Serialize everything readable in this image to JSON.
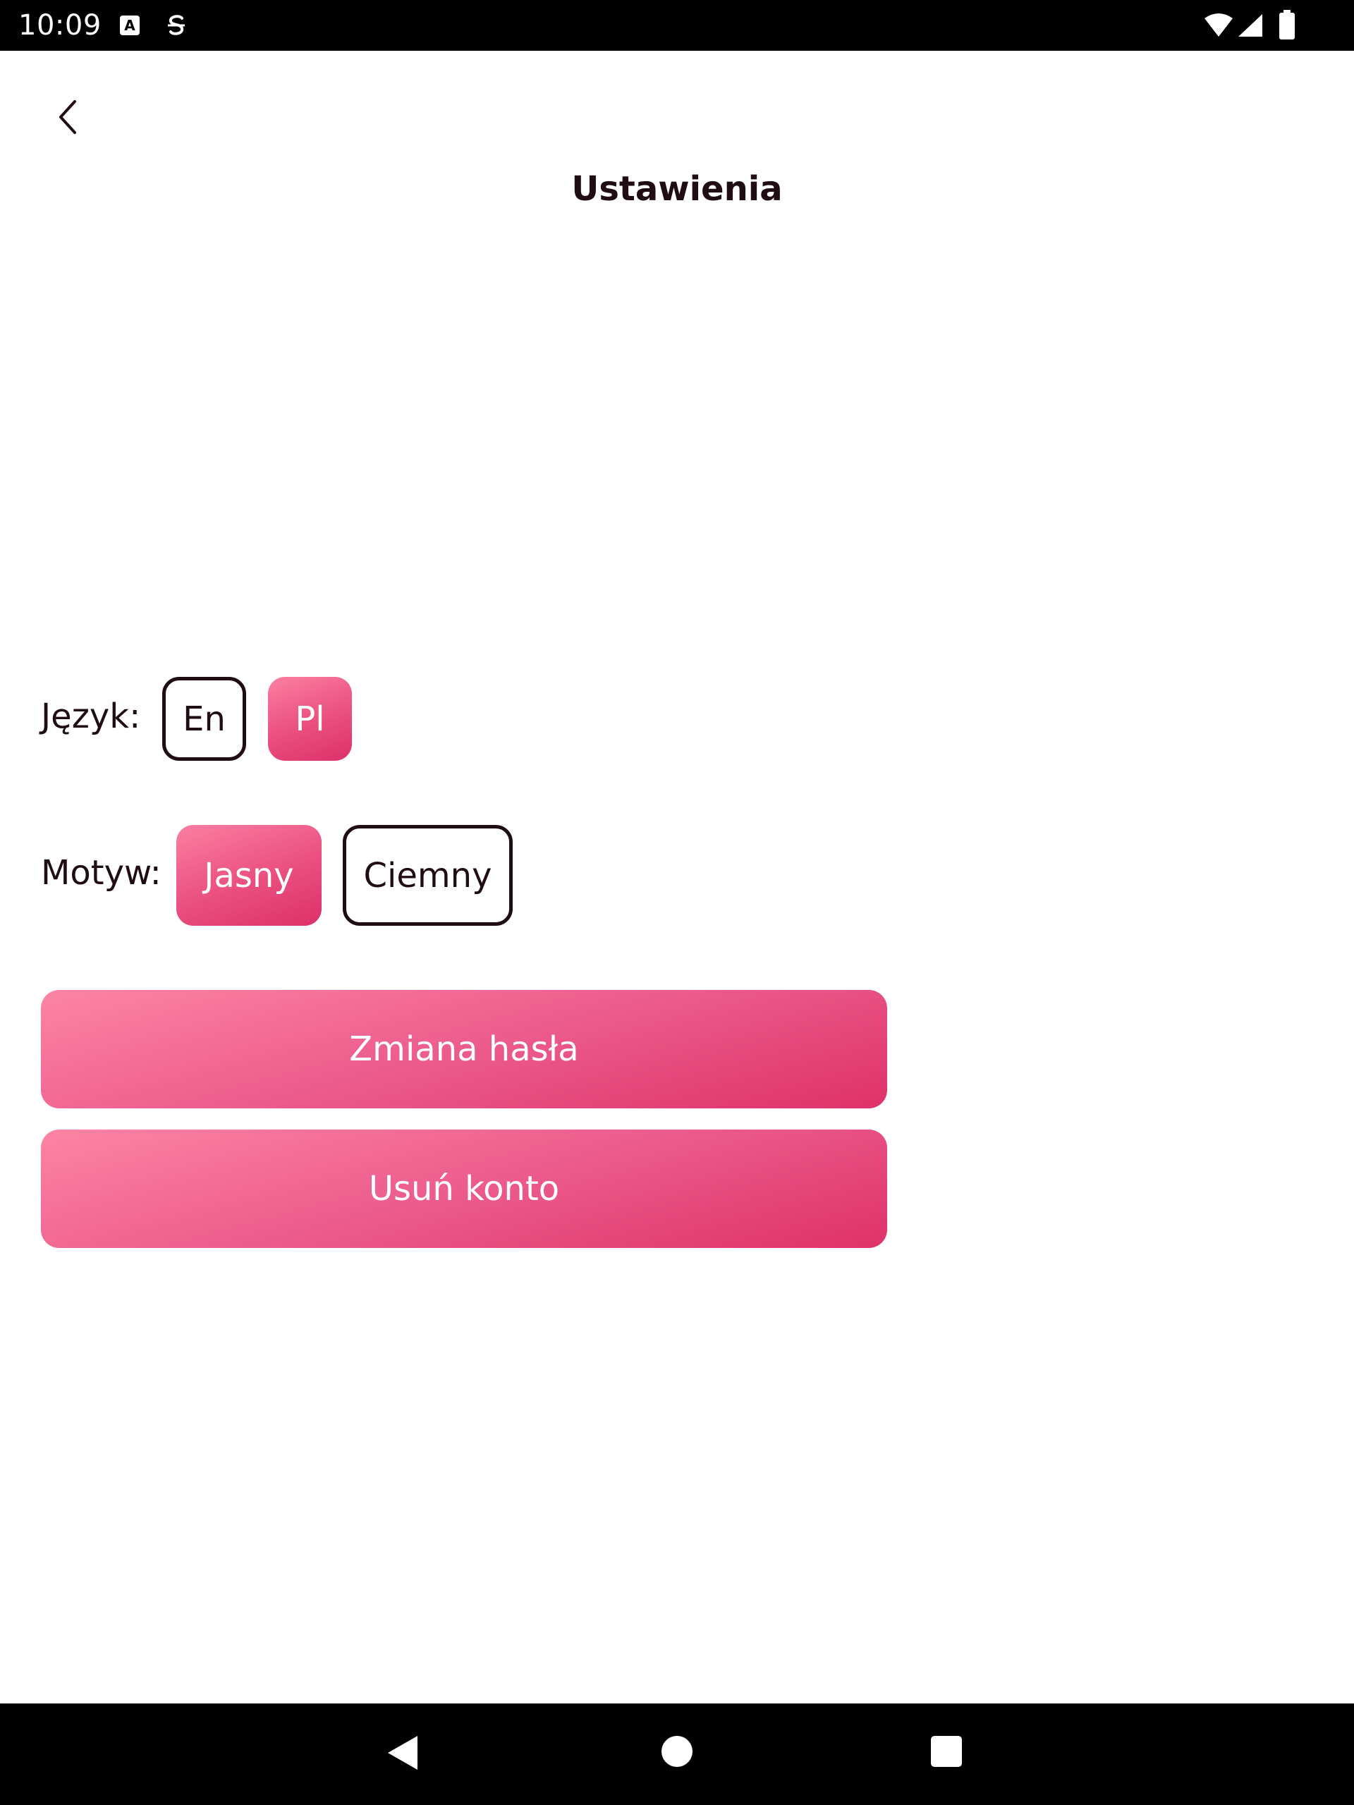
{
  "status_bar": {
    "time": "10:09",
    "icons": [
      "a-badge-icon",
      "sync-icon",
      "wifi-icon",
      "signal-icon",
      "battery-icon"
    ]
  },
  "header": {
    "back_icon": "chevron-left-icon",
    "title": "Ustawienia"
  },
  "language": {
    "label": "Język:",
    "options": [
      {
        "label": "En",
        "selected": false
      },
      {
        "label": "Pl",
        "selected": true
      }
    ]
  },
  "theme": {
    "label": "Motyw:",
    "options": [
      {
        "label": "Jasny",
        "selected": true
      },
      {
        "label": "Ciemny",
        "selected": false
      }
    ]
  },
  "actions": {
    "change_password": "Zmiana hasła",
    "delete_account": "Usuń konto"
  },
  "nav_bar": {
    "icons": [
      "back-triangle-icon",
      "home-circle-icon",
      "recents-square-icon"
    ]
  },
  "colors": {
    "accent_start": "#fb7fa2",
    "accent_end": "#dc3169",
    "text": "#1f0d12"
  }
}
